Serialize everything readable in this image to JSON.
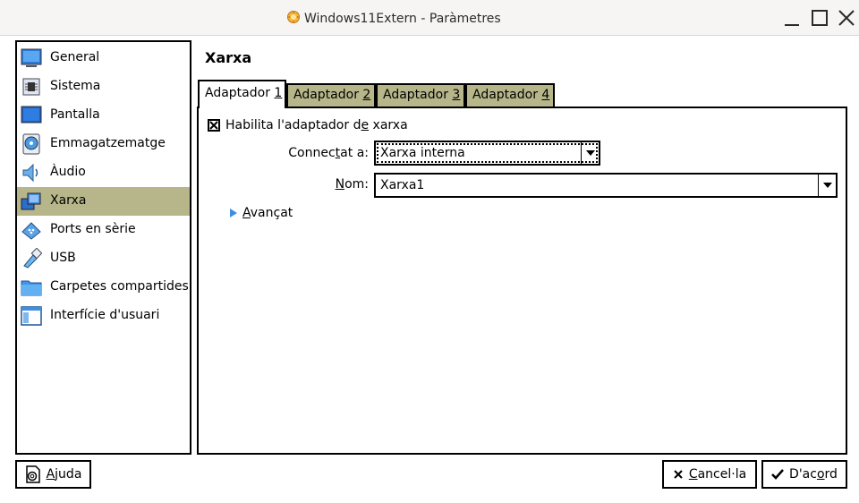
{
  "window": {
    "title": "Windows11Extern - Paràmetres",
    "icon": "virtualbox-app-icon",
    "controls": [
      "minimize-icon",
      "maximize-icon",
      "close-icon"
    ]
  },
  "sidebar": {
    "items": [
      {
        "label": "General",
        "icon": "general-monitor-icon",
        "selected": false
      },
      {
        "label": "Sistema",
        "icon": "system-chip-icon",
        "selected": false
      },
      {
        "label": "Pantalla",
        "icon": "display-monitor-icon",
        "selected": false
      },
      {
        "label": "Emmagatzematge",
        "icon": "storage-disk-icon",
        "selected": false
      },
      {
        "label": "Àudio",
        "icon": "audio-speaker-icon",
        "selected": false
      },
      {
        "label": "Xarxa",
        "icon": "network-icon",
        "selected": true
      },
      {
        "label": "Ports en sèrie",
        "icon": "serial-port-icon",
        "selected": false
      },
      {
        "label": "USB",
        "icon": "usb-icon",
        "selected": false
      },
      {
        "label": "Carpetes compartides",
        "icon": "shared-folder-icon",
        "selected": false
      },
      {
        "label": "Interfície d'usuari",
        "icon": "user-interface-icon",
        "selected": false
      }
    ]
  },
  "page": {
    "title": "Xarxa"
  },
  "tabs": [
    {
      "pre": "Adaptador ",
      "key": "1",
      "active": true
    },
    {
      "pre": "Adaptador ",
      "key": "2",
      "active": false
    },
    {
      "pre": "Adaptador ",
      "key": "3",
      "active": false
    },
    {
      "pre": "Adaptador ",
      "key": "4",
      "active": false
    }
  ],
  "adapter": {
    "enable": {
      "pre": "Habilita l'adaptador d",
      "key": "e",
      "post": " xarxa",
      "checked": true
    },
    "attached": {
      "pre": "Connec",
      "key": "t",
      "post": "at a:",
      "value": "Xarxa interna"
    },
    "name": {
      "pre": "",
      "key": "N",
      "post": "om:",
      "value": "Xarxa1"
    },
    "advanced": {
      "pre": "",
      "key": "A",
      "post": "vançat"
    }
  },
  "buttons": {
    "help": {
      "pre": "",
      "key": "A",
      "post": "juda",
      "icon": "help-icon"
    },
    "cancel": {
      "pre": "",
      "key": "C",
      "post": "ancel·la",
      "icon": "cancel-x-icon"
    },
    "ok": {
      "pre": "D'ac",
      "key": "o",
      "post": "rd",
      "icon": "checkmark-icon"
    }
  },
  "colors": {
    "selection": "#b6b68a",
    "arrow_accent": "#3c8de6"
  }
}
